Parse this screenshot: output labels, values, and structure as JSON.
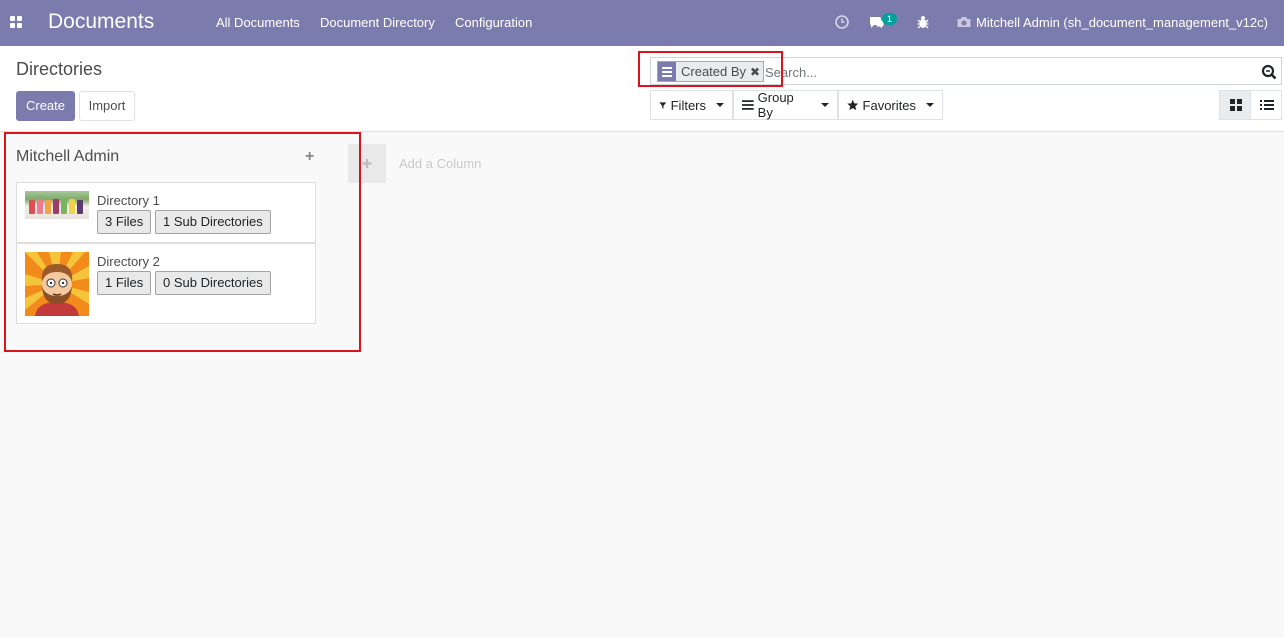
{
  "navbar": {
    "brand": "Documents",
    "menu": [
      "All Documents",
      "Document Directory",
      "Configuration"
    ],
    "chat_count": "1",
    "user": "Mitchell Admin (sh_document_management_v12c)"
  },
  "control_panel": {
    "title": "Directories",
    "create_label": "Create",
    "import_label": "Import",
    "facet_label": "Created By",
    "search_placeholder": "Search...",
    "filters_label": "Filters",
    "groupby_label": "Group By",
    "favorites_label": "Favorites"
  },
  "kanban": {
    "column_title": "Mitchell Admin",
    "add_column_label": "Add a Column",
    "cards": [
      {
        "name": "Directory 1",
        "files": "3 Files",
        "subdirs": "1 Sub Directories"
      },
      {
        "name": "Directory 2",
        "files": "1 Files",
        "subdirs": "0 Sub Directories"
      }
    ]
  },
  "colors": {
    "primary": "#7c7bad",
    "highlight": "#d9141a",
    "badge": "#00a09d"
  }
}
